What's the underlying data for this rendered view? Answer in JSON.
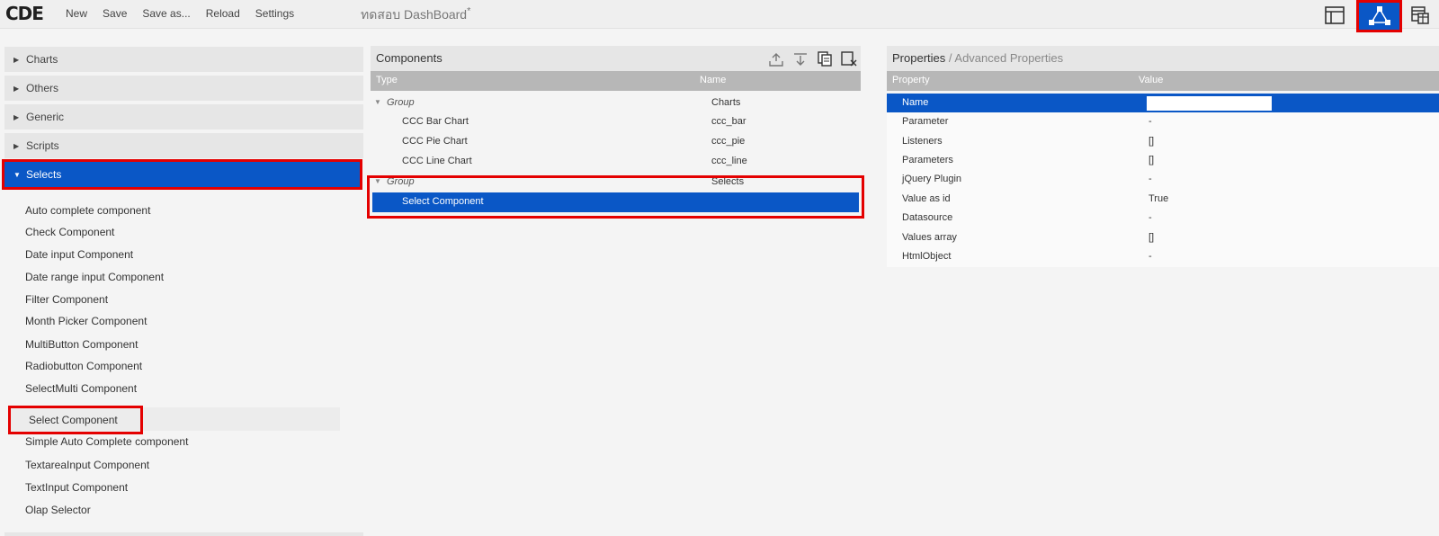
{
  "app": {
    "logo": "CDE",
    "menu": [
      "New",
      "Save",
      "Save as...",
      "Reload",
      "Settings"
    ],
    "dashboard_title": "ทดสอบ DashBoard",
    "dirty_marker": "*"
  },
  "toolbar_icons": [
    "layout-icon",
    "components-icon",
    "datasource-icon"
  ],
  "left_panel": {
    "categories": [
      {
        "label": "Charts",
        "expanded": false
      },
      {
        "label": "Others",
        "expanded": false
      },
      {
        "label": "Generic",
        "expanded": false
      },
      {
        "label": "Scripts",
        "expanded": false
      },
      {
        "label": "Selects",
        "expanded": true
      }
    ],
    "select_items": [
      "Auto complete component",
      "Check Component",
      "Date input Component",
      "Date range input Component",
      "Filter Component",
      "Month Picker Component",
      "MultiButton Component",
      "Radiobutton Component",
      "SelectMulti Component",
      "Select Component",
      "Simple Auto Complete component",
      "TextareaInput Component",
      "TextInput Component",
      "Olap Selector"
    ]
  },
  "components_panel": {
    "title": "Components",
    "tools": [
      "export-icon",
      "import-icon",
      "duplicate-icon",
      "delete-icon"
    ],
    "columns": [
      "Type",
      "Name"
    ],
    "rows": [
      {
        "type": "Group",
        "name": "Charts",
        "group": true
      },
      {
        "type": "CCC Bar Chart",
        "name": "ccc_bar",
        "group": false
      },
      {
        "type": "CCC Pie Chart",
        "name": "ccc_pie",
        "group": false
      },
      {
        "type": "CCC Line Chart",
        "name": "ccc_line",
        "group": false
      },
      {
        "type": "Group",
        "name": "Selects",
        "group": true
      },
      {
        "type": "Select Component",
        "name": "",
        "group": false,
        "selected": true
      }
    ]
  },
  "properties_panel": {
    "title": "Properties",
    "separator": "/",
    "advanced": "Advanced Properties",
    "columns": [
      "Property",
      "Value"
    ],
    "rows": [
      {
        "property": "Name",
        "value": "",
        "editing": true
      },
      {
        "property": "Parameter",
        "value": "-"
      },
      {
        "property": "Listeners",
        "value": "[]"
      },
      {
        "property": "Parameters",
        "value": "[]"
      },
      {
        "property": "jQuery Plugin",
        "value": "-"
      },
      {
        "property": "Value as id",
        "value": "True"
      },
      {
        "property": "Datasource",
        "value": "-"
      },
      {
        "property": "Values array",
        "value": "[]"
      },
      {
        "property": "HtmlObject",
        "value": "-"
      }
    ]
  },
  "colors": {
    "accent": "#0a57c6",
    "highlight": "#e40000"
  }
}
